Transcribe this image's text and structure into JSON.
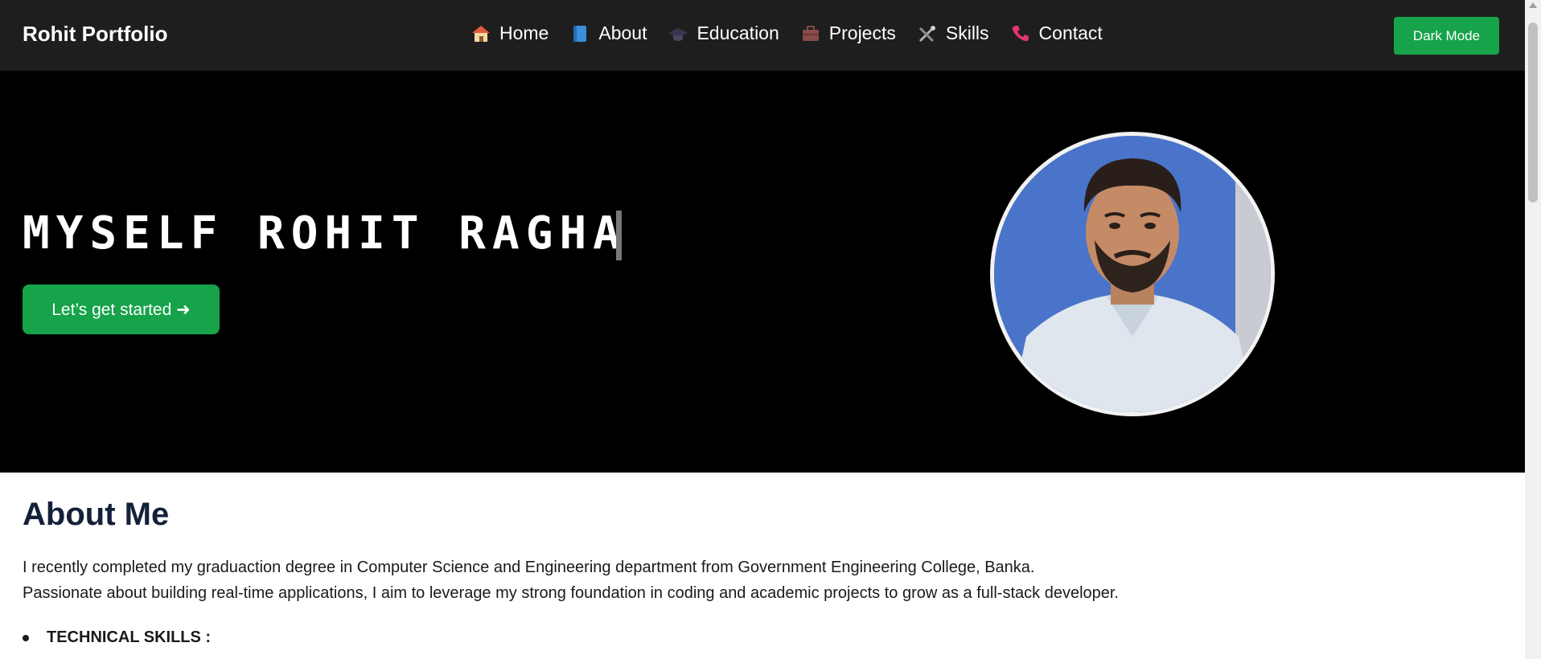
{
  "navbar": {
    "brand": "Rohit Portfolio",
    "links": [
      {
        "label": "Home",
        "icon": "home-icon"
      },
      {
        "label": "About",
        "icon": "book-icon"
      },
      {
        "label": "Education",
        "icon": "graduation-cap-icon"
      },
      {
        "label": "Projects",
        "icon": "briefcase-icon"
      },
      {
        "label": "Skills",
        "icon": "tools-icon"
      },
      {
        "label": "Contact",
        "icon": "phone-icon"
      }
    ],
    "dark_mode_label": "Dark Mode"
  },
  "hero": {
    "typed_text": "MYSELF ROHIT RAGHA",
    "cta_label": "Let’s get started ➜"
  },
  "about": {
    "title": "About Me",
    "paragraph_1": "I recently completed my graduaction degree in Computer Science and Engineering department from Government Engineering College, Banka.",
    "paragraph_2": "Passionate about building real-time applications, I aim to leverage my strong foundation in coding and academic projects to grow as a full-stack developer.",
    "skills_heading": "TECHNICAL SKILLS :"
  },
  "colors": {
    "navbar_bg": "#1e1e1e",
    "hero_bg": "#000000",
    "accent_green": "#16a34a",
    "heading_navy": "#13213a"
  }
}
